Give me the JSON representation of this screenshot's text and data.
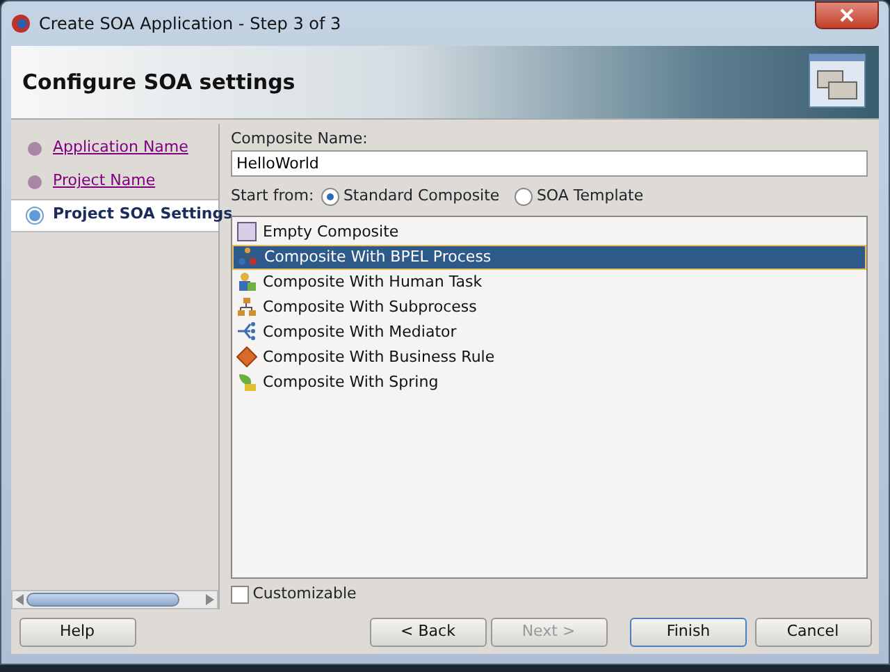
{
  "window": {
    "title": "Create SOA Application - Step 3 of 3"
  },
  "header": {
    "title": "Configure SOA settings"
  },
  "steps": [
    {
      "label": "Application Name",
      "selected": false
    },
    {
      "label": "Project Name",
      "selected": false
    },
    {
      "label": "Project SOA Settings",
      "selected": true
    }
  ],
  "composite_name": {
    "label": "Composite Name:",
    "value": "HelloWorld"
  },
  "start_from": {
    "label": "Start from:",
    "options": [
      {
        "label": "Standard Composite",
        "selected": true
      },
      {
        "label": "SOA Template",
        "selected": false
      }
    ]
  },
  "templates": [
    {
      "label": "Empty Composite",
      "kind": "empty",
      "selected": false
    },
    {
      "label": "Composite With BPEL Process",
      "kind": "bpel",
      "selected": true
    },
    {
      "label": "Composite With Human Task",
      "kind": "human",
      "selected": false
    },
    {
      "label": "Composite With Subprocess",
      "kind": "subprocess",
      "selected": false
    },
    {
      "label": "Composite With Mediator",
      "kind": "mediator",
      "selected": false
    },
    {
      "label": "Composite With Business Rule",
      "kind": "rule",
      "selected": false
    },
    {
      "label": "Composite With Spring",
      "kind": "spring",
      "selected": false
    }
  ],
  "customizable": {
    "label": "Customizable",
    "checked": false
  },
  "buttons": [
    {
      "label": "Help",
      "disabled": false,
      "default": false
    },
    {
      "label": "< Back",
      "disabled": false,
      "default": false
    },
    {
      "label": "Next >",
      "disabled": true,
      "default": false
    },
    {
      "label": "Finish",
      "disabled": false,
      "default": true
    },
    {
      "label": "Cancel",
      "disabled": false,
      "default": false
    }
  ]
}
